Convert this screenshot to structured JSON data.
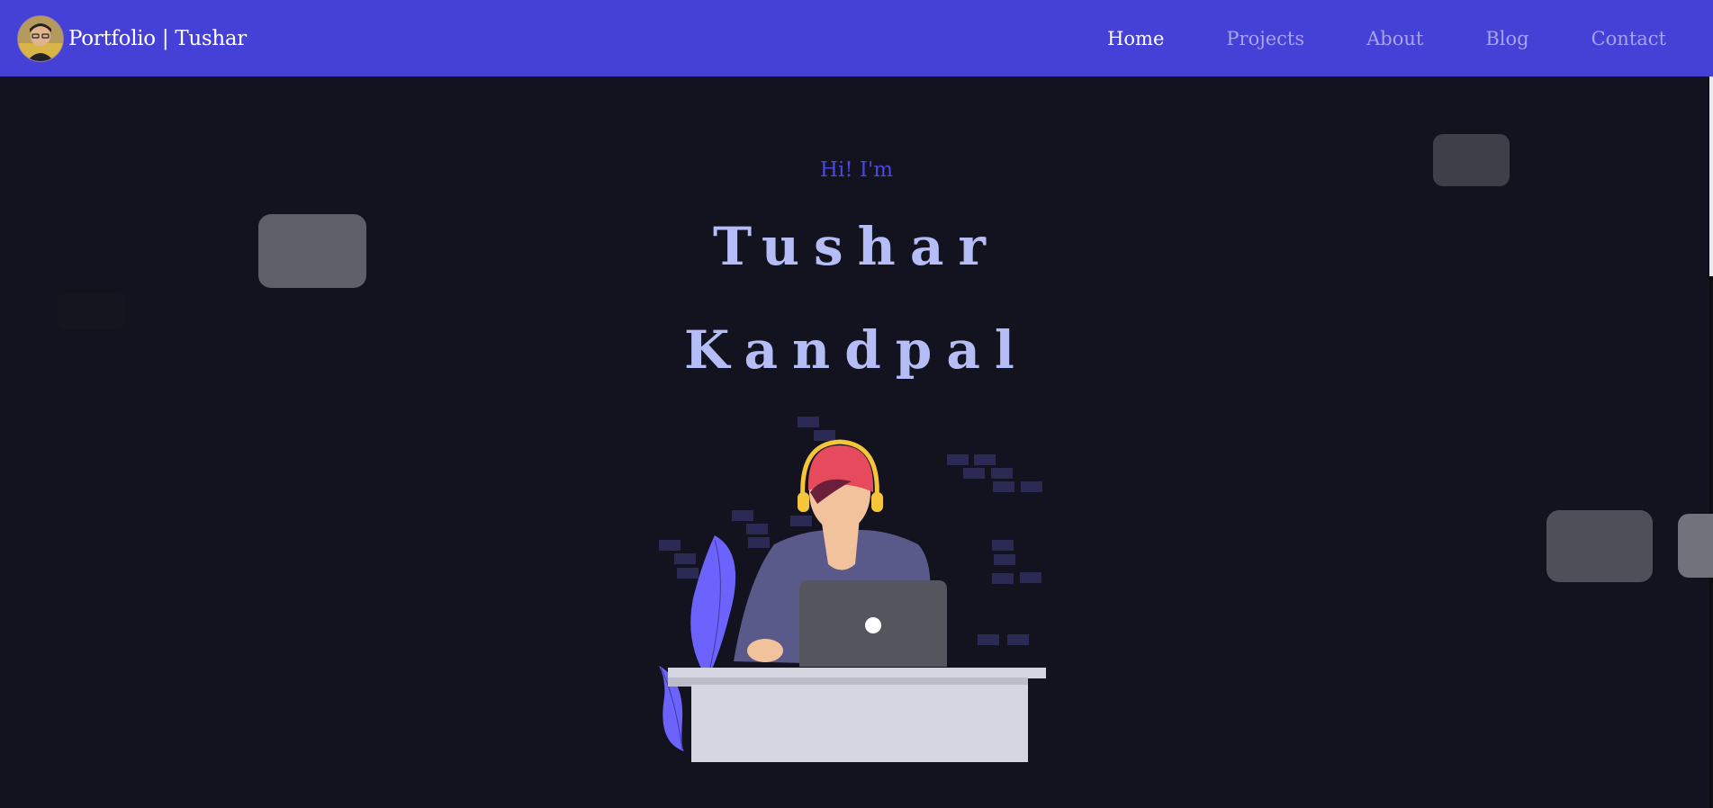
{
  "navbar": {
    "brand": "Portfolio | Tushar",
    "links": [
      {
        "label": "Home",
        "active": true
      },
      {
        "label": "Projects",
        "active": false
      },
      {
        "label": "About",
        "active": false
      },
      {
        "label": "Blog",
        "active": false
      },
      {
        "label": "Contact",
        "active": false
      }
    ]
  },
  "hero": {
    "greeting": "Hi! I'm",
    "first_name": "Tushar",
    "last_name": "Kandpal"
  },
  "colors": {
    "background": "#13131f",
    "navbar": "#4540d6",
    "accent": "#4a46e0",
    "name_text": "#b4bdf5"
  },
  "icons": {
    "avatar": "profile-photo",
    "illustration": "developer-with-headphones-at-laptop-illustration"
  }
}
